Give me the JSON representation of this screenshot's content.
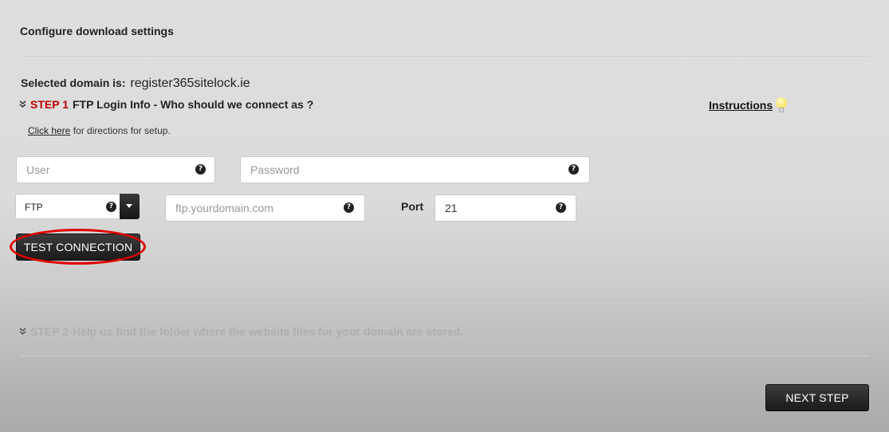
{
  "header": {
    "title": "Configure download settings"
  },
  "domain": {
    "label": "Selected domain is:",
    "value": "register365sitelock.ie"
  },
  "step1": {
    "number": "STEP 1",
    "title": "FTP Login Info - Who should we connect as ?",
    "help_link": "Click here",
    "help_text": " for directions for setup."
  },
  "instructions": {
    "label": "Instructions"
  },
  "form": {
    "user_placeholder": "User",
    "password_placeholder": "Password",
    "protocol_value": "FTP",
    "host_placeholder": "ftp.yourdomain.com",
    "port_label": "Port",
    "port_value": "21",
    "help_glyph": "?"
  },
  "buttons": {
    "test_connection": "TEST CONNECTION",
    "next_step": "NEXT STEP"
  },
  "step2": {
    "number": "STEP 2",
    "title": "Help us find the folder where the website files for your domain are stored."
  },
  "icons": {
    "expand": "chevron-double-down-icon",
    "help": "question-circle-icon",
    "tip": "lightbulb-icon",
    "dropdown": "caret-down-icon"
  },
  "colors": {
    "step_accent": "#c00000",
    "highlight_ring": "#e00000",
    "button_dark": "#222222",
    "disabled_text": "#aeaeae"
  }
}
